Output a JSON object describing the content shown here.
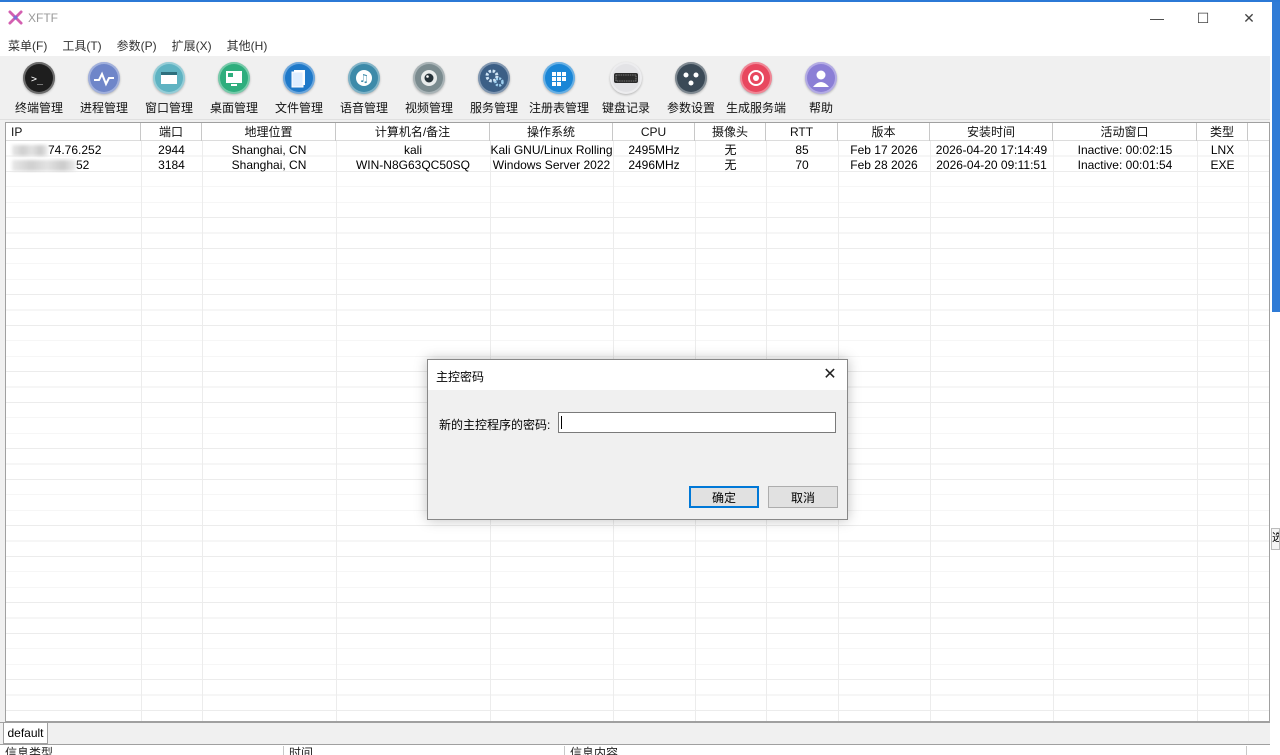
{
  "window": {
    "title": "XFTF",
    "controls": {
      "minimize": "—",
      "maximize": "☐",
      "close": "✕"
    }
  },
  "menu": [
    "菜单(F)",
    "工具(T)",
    "参数(P)",
    "扩展(X)",
    "其他(H)"
  ],
  "toolbar": [
    {
      "label": "终端管理",
      "icon": "terminal-icon",
      "color": "#1e1e1e"
    },
    {
      "label": "进程管理",
      "icon": "process-icon",
      "color": "#6f86c9"
    },
    {
      "label": "窗口管理",
      "icon": "window-icon",
      "color": "#5fb3c2"
    },
    {
      "label": "桌面管理",
      "icon": "desktop-icon",
      "color": "#2eae7d"
    },
    {
      "label": "文件管理",
      "icon": "file-icon",
      "color": "#1f79c9"
    },
    {
      "label": "语音管理",
      "icon": "audio-icon",
      "color": "#3d8aa9"
    },
    {
      "label": "视频管理",
      "icon": "video-icon",
      "color": "#7b8b8f"
    },
    {
      "label": "服务管理",
      "icon": "service-icon",
      "color": "#3c5f86"
    },
    {
      "label": "注册表管理",
      "icon": "registry-icon",
      "color": "#1a86d6"
    },
    {
      "label": "键盘记录",
      "icon": "keyboard-icon",
      "color": "#e3e3e6"
    },
    {
      "label": "参数设置",
      "icon": "settings-icon",
      "color": "#3b4a57"
    },
    {
      "label": "生成服务端",
      "icon": "build-icon",
      "color": "#e8475f"
    },
    {
      "label": "帮助",
      "icon": "help-icon",
      "color": "#8b7fd6"
    }
  ],
  "table": {
    "columns": [
      "IP",
      "端口",
      "地理位置",
      "计算机名/备注",
      "操作系统",
      "CPU",
      "摄像头",
      "RTT",
      "版本",
      "安装时间",
      "活动窗口",
      "类型"
    ],
    "rows": [
      {
        "ip": "74.76.252",
        "port": "2944",
        "location": "Shanghai, CN",
        "name": "kali",
        "os": "Kali GNU/Linux Rolling",
        "cpu": "2495MHz",
        "camera": "无",
        "rtt": "85",
        "version": "Feb 17 2026",
        "install_time": "2026-04-20 17:14:49",
        "active_window": "Inactive: 00:02:15",
        "type": "LNX"
      },
      {
        "ip": "52",
        "port": "3184",
        "location": "Shanghai, CN",
        "name": "WIN-N8G63QC50SQ",
        "os": "Windows Server 2022",
        "cpu": "2496MHz",
        "camera": "无",
        "rtt": "70",
        "version": "Feb 28 2026",
        "install_time": "2026-04-20 09:11:51",
        "active_window": "Inactive: 00:01:54",
        "type": "EXE"
      }
    ]
  },
  "tabs": [
    "default"
  ],
  "log_columns": [
    "信息类型",
    "时间",
    "信息内容"
  ],
  "dialog": {
    "title": "主控密码",
    "label": "新的主控程序的密码:",
    "value": "",
    "ok": "确定",
    "cancel": "取消",
    "close": "✕"
  },
  "side_glyph": "选"
}
